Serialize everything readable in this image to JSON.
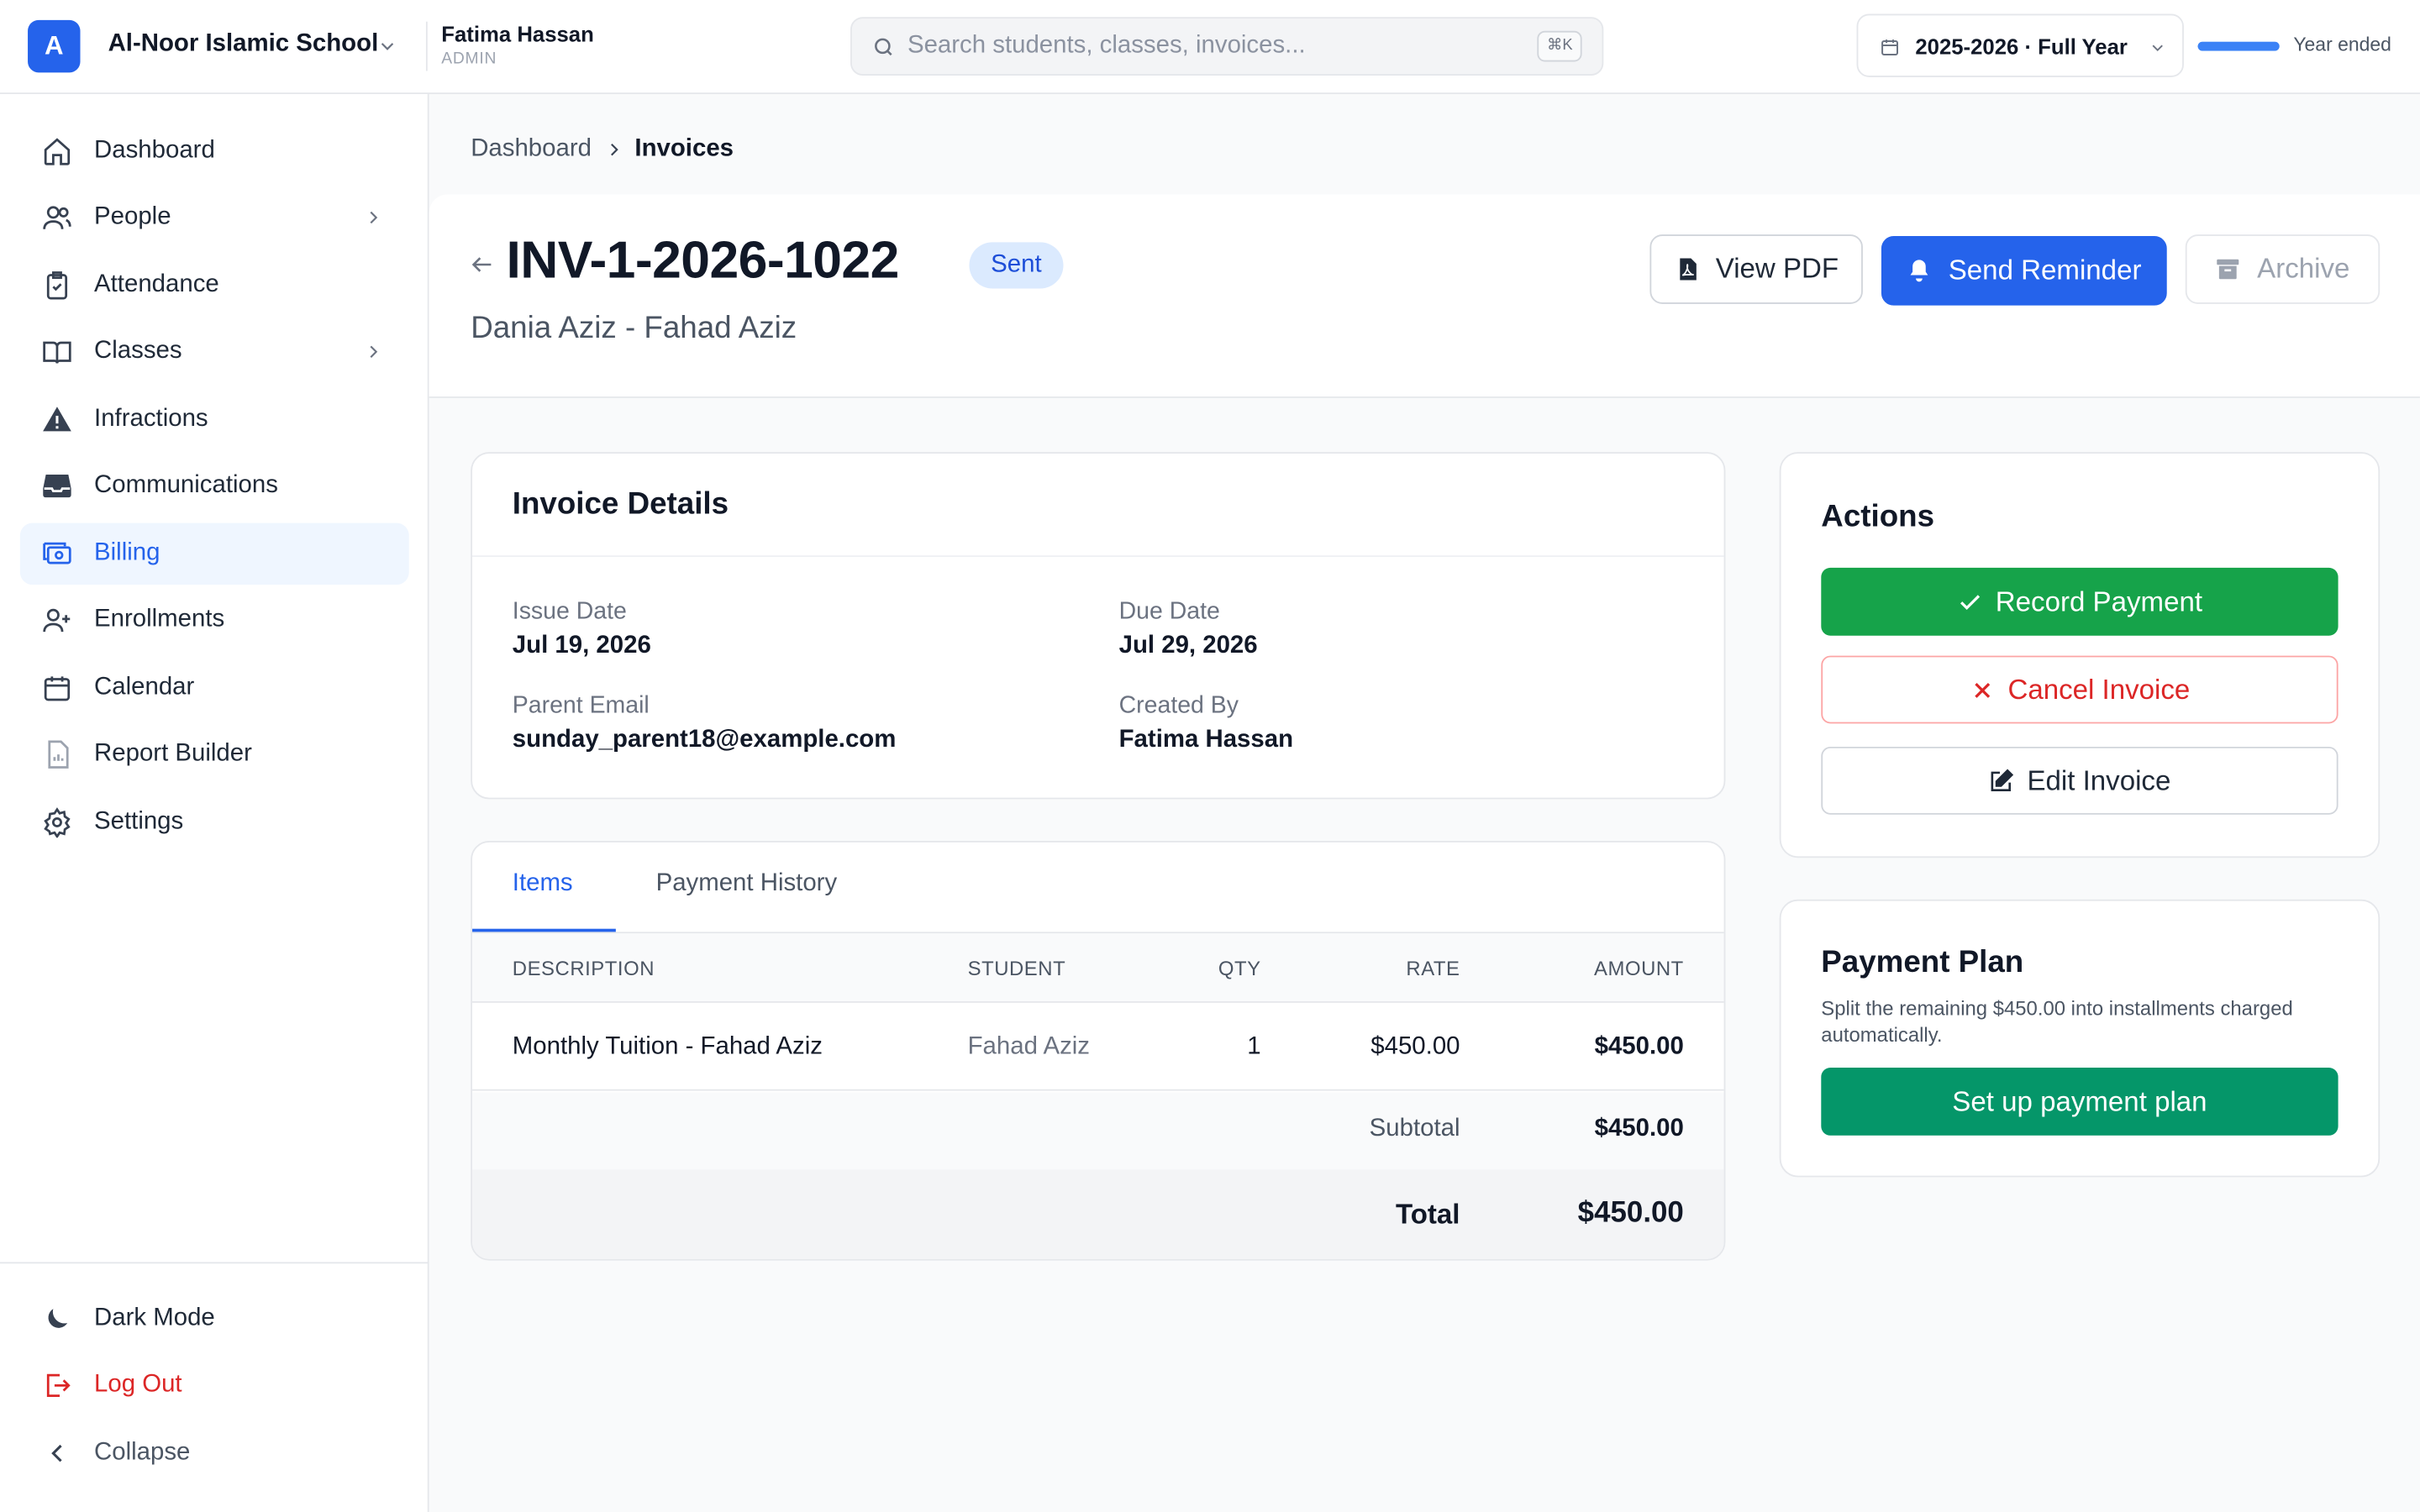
{
  "app": {
    "logo_letter": "A",
    "school_name": "Al-Noor Islamic School",
    "user_name": "Fatima Hassan",
    "user_role": "ADMIN",
    "search_placeholder": "Search students, classes, invoices...",
    "search_shortcut": "⌘K",
    "school_year": "2025-2026 · Full Year",
    "year_progress": 1.0,
    "year_status": "Year ended"
  },
  "sidebar": {
    "items": [
      {
        "label": "Dashboard",
        "icon": "home-icon"
      },
      {
        "label": "People",
        "icon": "users-icon",
        "has_children": true
      },
      {
        "label": "Attendance",
        "icon": "clipboard-check-icon"
      },
      {
        "label": "Classes",
        "icon": "book-open-icon",
        "has_children": true
      },
      {
        "label": "Infractions",
        "icon": "warning-icon"
      },
      {
        "label": "Communications",
        "icon": "inbox-icon"
      },
      {
        "label": "Billing",
        "icon": "cash-icon",
        "active": true
      },
      {
        "label": "Enrollments",
        "icon": "user-add-icon"
      },
      {
        "label": "Calendar",
        "icon": "calendar-icon"
      },
      {
        "label": "Report Builder",
        "icon": "document-report-icon"
      },
      {
        "label": "Settings",
        "icon": "cog-icon"
      }
    ],
    "footer": {
      "dark_mode": "Dark Mode",
      "logout": "Log Out",
      "collapse": "Collapse"
    }
  },
  "breadcrumb": {
    "root": "Dashboard",
    "current": "Invoices"
  },
  "invoice": {
    "number": "INV-1-2026-1022",
    "status": "Sent",
    "subtitle": "Dania Aziz - Fahad Aziz",
    "buttons": {
      "view_pdf": "View PDF",
      "send_reminder": "Send Reminder",
      "archive": "Archive"
    },
    "details": {
      "title": "Invoice Details",
      "issue_date_label": "Issue Date",
      "issue_date": "Jul 19, 2026",
      "due_date_label": "Due Date",
      "due_date": "Jul 29, 2026",
      "parent_email_label": "Parent Email",
      "parent_email": "sunday_parent18@example.com",
      "created_by_label": "Created By",
      "created_by": "Fatima Hassan"
    },
    "tabs": [
      "Items",
      "Payment History"
    ],
    "table": {
      "columns": [
        "DESCRIPTION",
        "STUDENT",
        "QTY",
        "RATE",
        "AMOUNT"
      ],
      "rows": [
        {
          "description": "Monthly Tuition - Fahad Aziz",
          "student": "Fahad Aziz",
          "qty": "1",
          "rate": "$450.00",
          "amount": "$450.00"
        }
      ],
      "subtotal_label": "Subtotal",
      "subtotal": "$450.00",
      "total_label": "Total",
      "total": "$450.00"
    }
  },
  "actions": {
    "title": "Actions",
    "record_payment": "Record Payment",
    "cancel_invoice": "Cancel Invoice",
    "edit_invoice": "Edit Invoice"
  },
  "payment_plan": {
    "title": "Payment Plan",
    "description": "Split the remaining $450.00 into installments charged automatically.",
    "button": "Set up payment plan"
  },
  "colors": {
    "primary": "#2563eb",
    "success": "#16a34a",
    "danger": "#dc2626",
    "plan": "#059669"
  }
}
